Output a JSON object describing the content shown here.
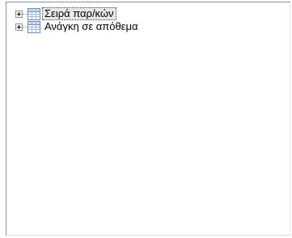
{
  "tree": {
    "nodes": [
      {
        "label": "Σειρά παρ/κών",
        "icon": "table-icon",
        "expanded": false,
        "selected": true
      },
      {
        "label": "Ανάγκη σε απόθεμα",
        "icon": "table-icon",
        "expanded": false,
        "selected": false
      }
    ]
  },
  "colors": {
    "icon_border": "#6c8fb7",
    "icon_header": "#c9dcef",
    "icon_cell": "#ffffff"
  }
}
